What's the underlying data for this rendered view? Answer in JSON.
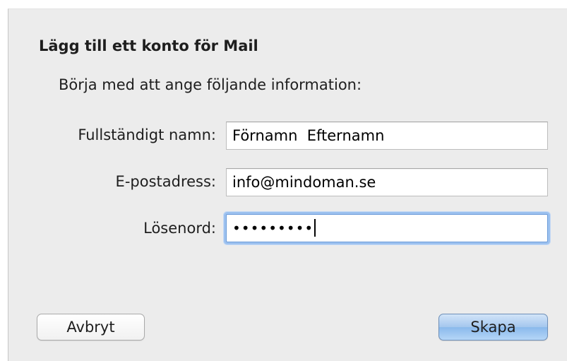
{
  "dialog": {
    "title": "Lägg till ett konto för Mail",
    "subtitle": "Börja med att ange följande information:"
  },
  "form": {
    "full_name": {
      "label": "Fullständigt namn:",
      "value": "Förnamn  Efternamn"
    },
    "email": {
      "label": "E-postadress:",
      "value": "info@mindoman.se"
    },
    "password": {
      "label": "Lösenord:",
      "masked_value": "•••••••••"
    }
  },
  "buttons": {
    "cancel_label": "Avbryt",
    "create_label": "Skapa"
  },
  "colors": {
    "sheet_background": "#ececec",
    "default_button_blue": "#a4c7ee",
    "focus_ring": "#9cc1ef"
  }
}
